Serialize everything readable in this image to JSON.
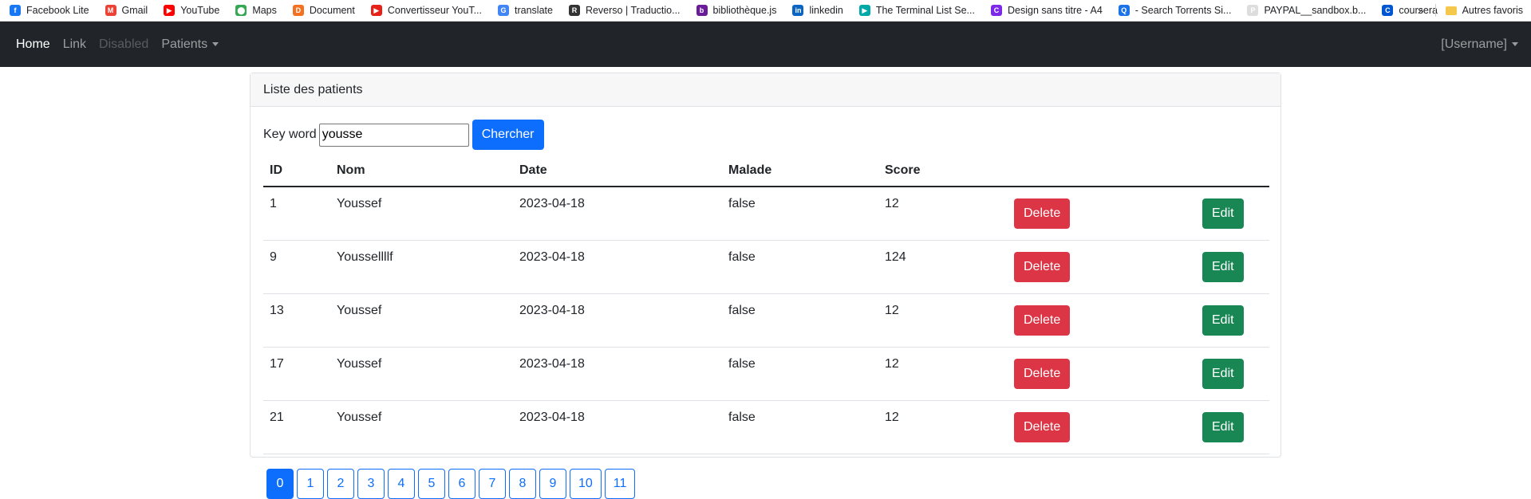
{
  "bookmarks": [
    {
      "label": "Facebook Lite",
      "icon": "facebook-icon",
      "color": "#1877f2",
      "glyph": "f"
    },
    {
      "label": "Gmail",
      "icon": "gmail-icon",
      "color": "#ea4335",
      "glyph": "M"
    },
    {
      "label": "YouTube",
      "icon": "youtube-icon",
      "color": "#ff0000",
      "glyph": "▶"
    },
    {
      "label": "Maps",
      "icon": "maps-icon",
      "color": "#34a853",
      "glyph": "⬤"
    },
    {
      "label": "Document",
      "icon": "document-icon",
      "color": "#f37121",
      "glyph": "D"
    },
    {
      "label": "Convertisseur YouT...",
      "icon": "converter-icon",
      "color": "#e62117",
      "glyph": "▶"
    },
    {
      "label": "translate",
      "icon": "translate-icon",
      "color": "#4285f4",
      "glyph": "G"
    },
    {
      "label": "Reverso | Traductio...",
      "icon": "reverso-icon",
      "color": "#333333",
      "glyph": "R"
    },
    {
      "label": "bibliothèque.js",
      "icon": "library-icon",
      "color": "#6a1b9a",
      "glyph": "b"
    },
    {
      "label": "linkedin",
      "icon": "linkedin-icon",
      "color": "#0a66c2",
      "glyph": "in"
    },
    {
      "label": "The Terminal List Se...",
      "icon": "terminal-list-icon",
      "color": "#00a8a8",
      "glyph": "▶"
    },
    {
      "label": "Design sans titre - A4",
      "icon": "canva-icon",
      "color": "#7d2ae8",
      "glyph": "C"
    },
    {
      "label": "- Search Torrents Si...",
      "icon": "torrent-icon",
      "color": "#1a73e8",
      "glyph": "Q"
    },
    {
      "label": "PAYPAL__sandbox.b...",
      "icon": "paypal-icon",
      "color": "#dddddd",
      "glyph": "P"
    },
    {
      "label": "coursera",
      "icon": "coursera-icon",
      "color": "#0056d2",
      "glyph": "C"
    }
  ],
  "bookmarks_more": "»",
  "bookmarks_folder": "Autres favoris",
  "navbar": {
    "home": "Home",
    "link": "Link",
    "disabled": "Disabled",
    "patients": "Patients",
    "username": "[Username]"
  },
  "card": {
    "title": "Liste des patients",
    "search_label": "Key word",
    "search_value": "yousse",
    "search_button": "Chercher"
  },
  "table": {
    "headers": [
      "ID",
      "Nom",
      "Date",
      "Malade",
      "Score"
    ],
    "delete_label": "Delete",
    "edit_label": "Edit",
    "rows": [
      {
        "id": "1",
        "nom": "Youssef",
        "date": "2023-04-18",
        "malade": "false",
        "score": "12"
      },
      {
        "id": "9",
        "nom": "Youssellllf",
        "date": "2023-04-18",
        "malade": "false",
        "score": "124"
      },
      {
        "id": "13",
        "nom": "Youssef",
        "date": "2023-04-18",
        "malade": "false",
        "score": "12"
      },
      {
        "id": "17",
        "nom": "Youssef",
        "date": "2023-04-18",
        "malade": "false",
        "score": "12"
      },
      {
        "id": "21",
        "nom": "Youssef",
        "date": "2023-04-18",
        "malade": "false",
        "score": "12"
      }
    ]
  },
  "pagination": {
    "pages": [
      "0",
      "1",
      "2",
      "3",
      "4",
      "5",
      "6",
      "7",
      "8",
      "9",
      "10",
      "11"
    ],
    "current": "0"
  }
}
